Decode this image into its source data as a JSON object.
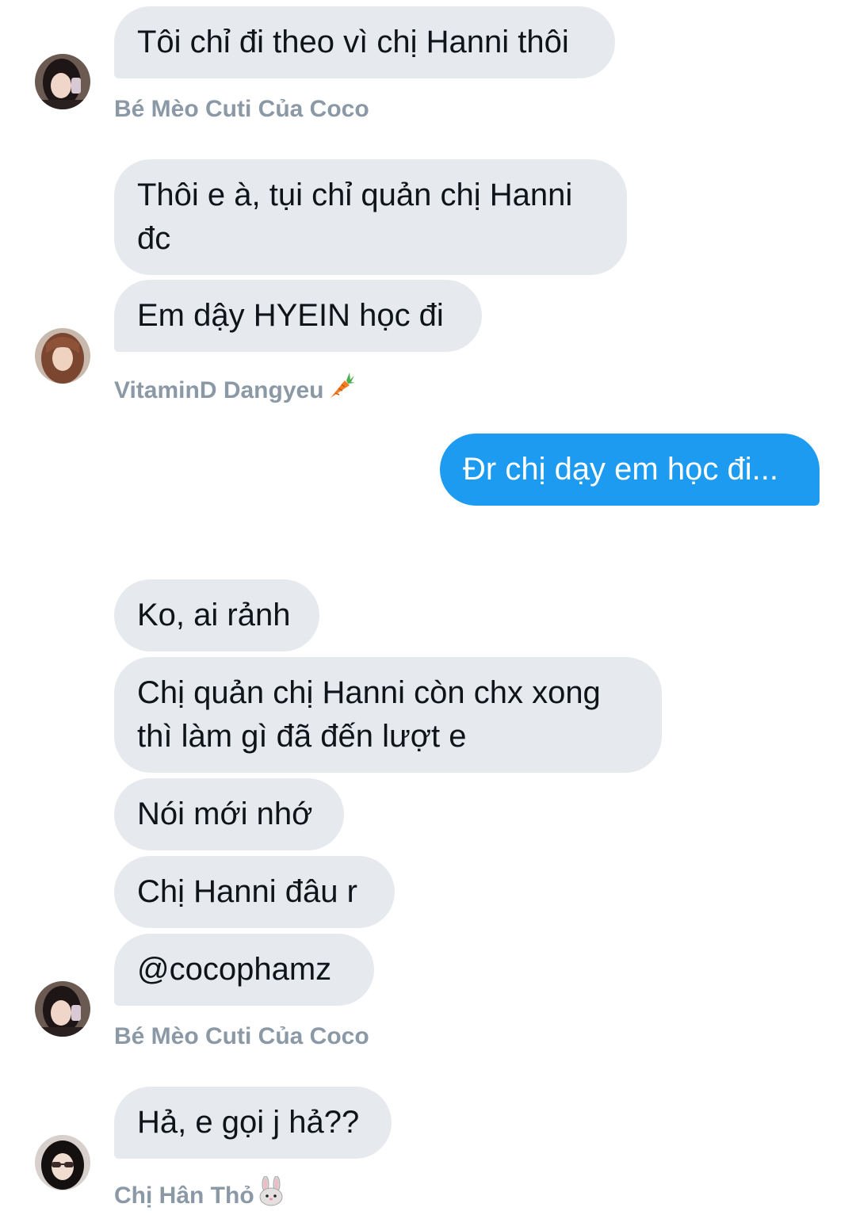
{
  "conversation": {
    "messages": [
      {
        "text": "Tôi chỉ đi theo vì chị Hanni thôi",
        "sender": "other"
      },
      {
        "text": "Thôi e à, tụi chỉ quản chị Hanni đc",
        "sender": "other"
      },
      {
        "text": "Em dậy HYEIN học đi",
        "sender": "other"
      },
      {
        "text": "Đr chị dạy em học đi...",
        "sender": "me"
      },
      {
        "text": "Ko, ai rảnh",
        "sender": "other"
      },
      {
        "text": "Chị quản chị Hanni còn chx xong thì làm gì đã đến lượt e",
        "sender": "other"
      },
      {
        "text": "Nói mới nhớ",
        "sender": "other"
      },
      {
        "text": "Chị Hanni đâu r",
        "sender": "other"
      },
      {
        "text": "@cocophamz",
        "sender": "other"
      },
      {
        "text": "Hả, e gọi j hả??",
        "sender": "other"
      }
    ],
    "senders": [
      {
        "name": "Bé Mèo Cuti Của Coco",
        "avatar": "avatar-dark-hair-selfie"
      },
      {
        "name": "VitaminD Dangyeu",
        "emoji": "carrot-emoji",
        "avatar": "avatar-auburn-hair"
      },
      {
        "name": "Bé Mèo Cuti Của Coco",
        "avatar": "avatar-dark-hair-selfie"
      },
      {
        "name": "Chị Hân Thỏ",
        "emoji": "rabbit-emoji",
        "avatar": "avatar-sunglasses"
      }
    ]
  },
  "colors": {
    "received_bubble": "#e6e9ee",
    "sent_bubble": "#1d9bf0",
    "sender_name": "#8b98a5",
    "message_text": "#0f1419"
  }
}
